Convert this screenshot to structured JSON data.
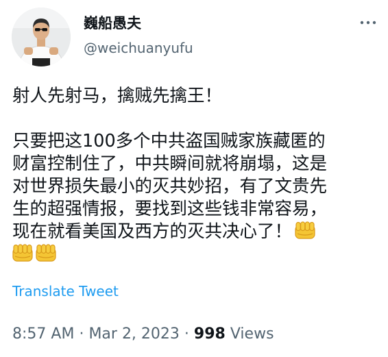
{
  "author": {
    "display_name": "巍船愚夫",
    "handle": "@weichuanyufu"
  },
  "tweet": {
    "line1": "射人先射马，擒贼先擒王！",
    "para2_line1": "只要把这100多个中共盗国贼家族藏匿的",
    "para2_line2": "财富控制住了，中共瞬间就将崩塌，这是",
    "para2_line3": "对世界损失最小的灭共妙招，有了文贵先",
    "para2_line4": "生的超强情报，要找到这些钱非常容易，",
    "para2_line5": "现在就看美国及西方的灭共决心了！",
    "emoji_name": "oncoming-fist-icon",
    "emoji_count": 3
  },
  "translate_label": "Translate Tweet",
  "meta": {
    "time": "8:57 AM",
    "separator": "·",
    "date": "Mar 2, 2023",
    "views_count": "998",
    "views_label": "Views"
  },
  "colors": {
    "text_primary": "#0f1419",
    "text_secondary": "#536471",
    "link": "#1d9bf0",
    "emoji_fill": "#f4c534",
    "emoji_outline": "#d99a1b"
  },
  "icons": {
    "more": "more-horizontal-icon",
    "avatar": "profile-photo"
  }
}
